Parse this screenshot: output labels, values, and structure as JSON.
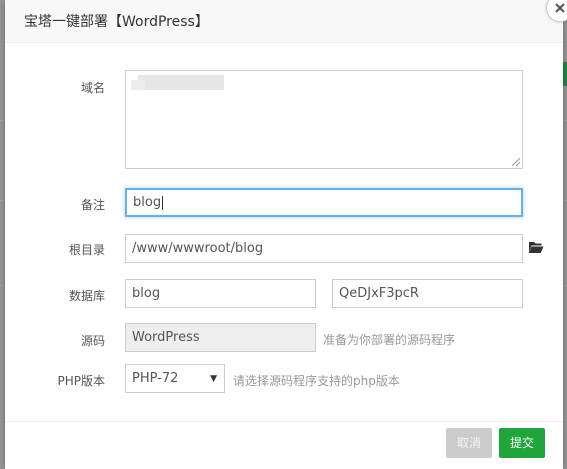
{
  "dialog": {
    "title": "宝塔一键部署【WordPress】"
  },
  "form": {
    "domain": {
      "label": "域名",
      "value": ""
    },
    "remark": {
      "label": "备注",
      "value": "blog"
    },
    "root": {
      "label": "根目录",
      "value": "/www/wwwroot/blog"
    },
    "database": {
      "label": "数据库",
      "name_value": "blog",
      "password_value": "QeDJxF3pcR"
    },
    "source": {
      "label": "源码",
      "value": "WordPress",
      "help": "准备为你部署的源码程序"
    },
    "php": {
      "label": "PHP版本",
      "selected": "PHP-72",
      "help": "请选择源码程序支持的php版本"
    }
  },
  "buttons": {
    "cancel": "取消",
    "submit": "提交"
  },
  "icons": {
    "close": "close-icon",
    "folder": "folder-open-icon",
    "dropdown": "caret-down-icon"
  },
  "colors": {
    "primary": "#20a53a",
    "focus": "#66afe9",
    "disabled_button": "#cccccc"
  }
}
